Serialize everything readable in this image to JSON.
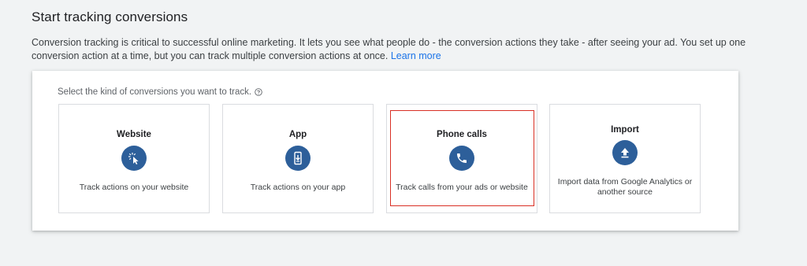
{
  "header": {
    "title": "Start tracking conversions",
    "intro_text": "Conversion tracking is critical to successful online marketing. It lets you see what people do - the conversion actions they take - after seeing your ad. You set up one conversion action at a time, but you can track multiple conversion actions at once.",
    "learn_more_label": "Learn more"
  },
  "panel": {
    "prompt": "Select the kind of conversions you want to track.",
    "help_icon": "help-circle-icon",
    "cards": [
      {
        "title": "Website",
        "icon": "cursor-click-icon",
        "description": "Track actions on your website"
      },
      {
        "title": "App",
        "icon": "mobile-download-icon",
        "description": "Track actions on your app"
      },
      {
        "title": "Phone calls",
        "icon": "phone-icon",
        "description": "Track calls from your ads or website",
        "highlighted": true
      },
      {
        "title": "Import",
        "icon": "upload-icon",
        "description": "Import data from Google Analytics or another source"
      }
    ]
  },
  "colors": {
    "icon_circle": "#2d5f9a",
    "link": "#1a73e8",
    "highlight_border": "#d93025"
  }
}
